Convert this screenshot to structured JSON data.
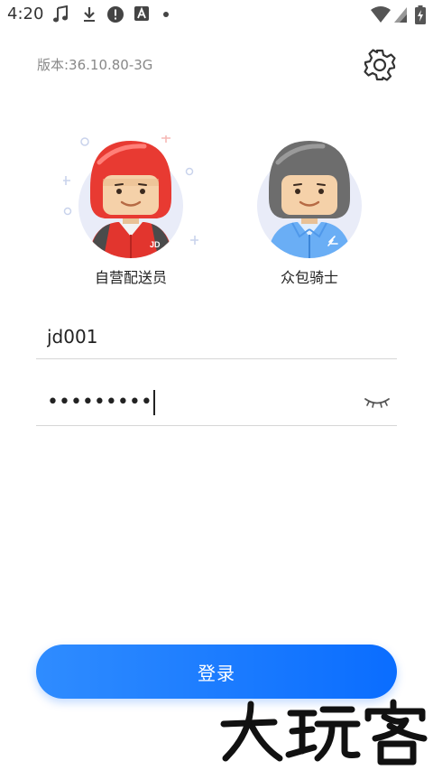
{
  "status_bar": {
    "time": "4:20",
    "icons": [
      "music-note-icon",
      "download-icon",
      "alert-icon",
      "app-a-icon",
      "dot-icon",
      "wifi-icon",
      "signal-icon",
      "battery-charging-icon"
    ]
  },
  "header": {
    "version_text": "版本:36.10.80-3G",
    "settings_icon": "gear-icon"
  },
  "roles": [
    {
      "label": "自营配送员",
      "helmet_color": "#e83a32",
      "shirt_color": "#e2352e",
      "badge": "JD"
    },
    {
      "label": "众包骑士",
      "helmet_color": "#6d6d6d",
      "shirt_color": "#6aaef5"
    }
  ],
  "form": {
    "username_value": "jd001",
    "password_masked": "•••••••••",
    "eye_icon": "eye-closed-icon"
  },
  "login": {
    "label": "登录"
  },
  "colors": {
    "accent": "#0a6dff",
    "accent_light": "#2f8cff",
    "divider": "#d6d6d6",
    "version_text": "#888888"
  },
  "watermark_icon": "dawanke-watermark"
}
